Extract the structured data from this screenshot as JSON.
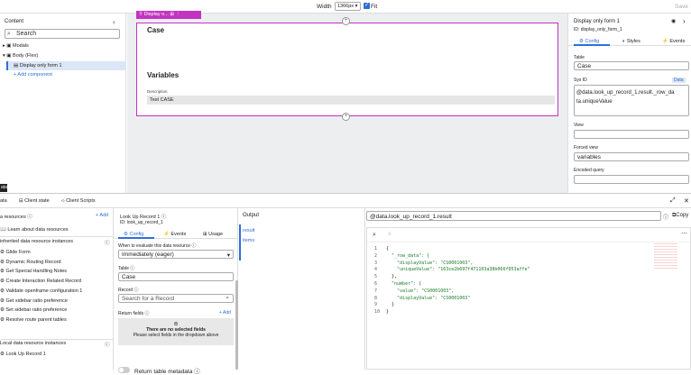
{
  "topbar": {
    "width_label": "Width",
    "width_value": "1366px",
    "fit_label": "Fit",
    "save_label": "Save"
  },
  "left_panel": {
    "title": "Content",
    "search_placeholder": "Search",
    "tree": [
      {
        "label": "Modals"
      },
      {
        "label": "Body (Flex)"
      },
      {
        "label": "Display only form 1"
      }
    ],
    "add_component": "+ Add component"
  },
  "canvas": {
    "chip_label": "Display o...",
    "heading_case": "Case",
    "heading_variables": "Variables",
    "desc_label": "Description",
    "desc_value": "Test CASE"
  },
  "right_panel": {
    "title": "Display only form 1",
    "id_text": "ID: display_only_form_1",
    "tabs": [
      "Config",
      "Styles",
      "Events"
    ],
    "table_label": "Table",
    "table_value": "Case",
    "sysid_label": "Sys ID",
    "data_badge": "Data",
    "sysid_line1": "@data.look_up_record_1.result._row_da",
    "sysid_line2": "ta.uniqueValue",
    "view_label": "View",
    "forced_view_label": "Forced view",
    "forced_view_value": "variables",
    "encoded_query_label": "Encoded query"
  },
  "bottom": {
    "tab_data": "ata",
    "tab_client_state": "Client state",
    "tab_client_scripts": "Client Scripts",
    "resources_title": "a resources",
    "add_label": "+ Add",
    "learn_link": "Learn about data resources",
    "inherited_title": "inherited data resource instances",
    "inherited_items": [
      "Glide Form",
      "Dynamic Routing Record",
      "Get Special Handling Notes",
      "Create Interaction Related Record",
      "Validate openframe configuration 1",
      "Get sidebar ratio preference",
      "Set sidebar ratio preference",
      "Resolve route parent tables"
    ],
    "local_title": "Local data resource instances",
    "local_items": [
      "Look Up Record 1"
    ],
    "lookup_title": "Look Up Record 1",
    "lookup_id": "ID: look_up_record_1",
    "lookup_tabs": [
      "Config",
      "Events",
      "Usage"
    ],
    "when_label": "When to evaluate this data resource",
    "when_value": "Immediately (eager)",
    "table_label": "Table",
    "table_value": "Case",
    "record_label": "Record",
    "record_placeholder": "Search for a Record",
    "return_fields_label": "Return fields",
    "return_add": "+ Add",
    "no_fields_title": "There are no selected fields",
    "no_fields_sub": "Please select fields in the dropdown above",
    "return_table_metadata": "Return table metadata",
    "output_title": "Output",
    "output_links": [
      "result",
      "items"
    ],
    "expression": "@data.look_up_record_1.result",
    "copy_label": "Copy",
    "code_lines": [
      "{",
      "  \"_row_data\": {",
      "    \"displayValue\": \"CS0001003\",",
      "    \"uniqueValue\": \"163ce2b697f471103a38b066f053affe\"",
      "  },",
      "  \"number\": {",
      "    \"value\": \"CS0001003\",",
      "    \"displayValue\": \"CS0001003\"",
      "  }",
      "}"
    ]
  }
}
